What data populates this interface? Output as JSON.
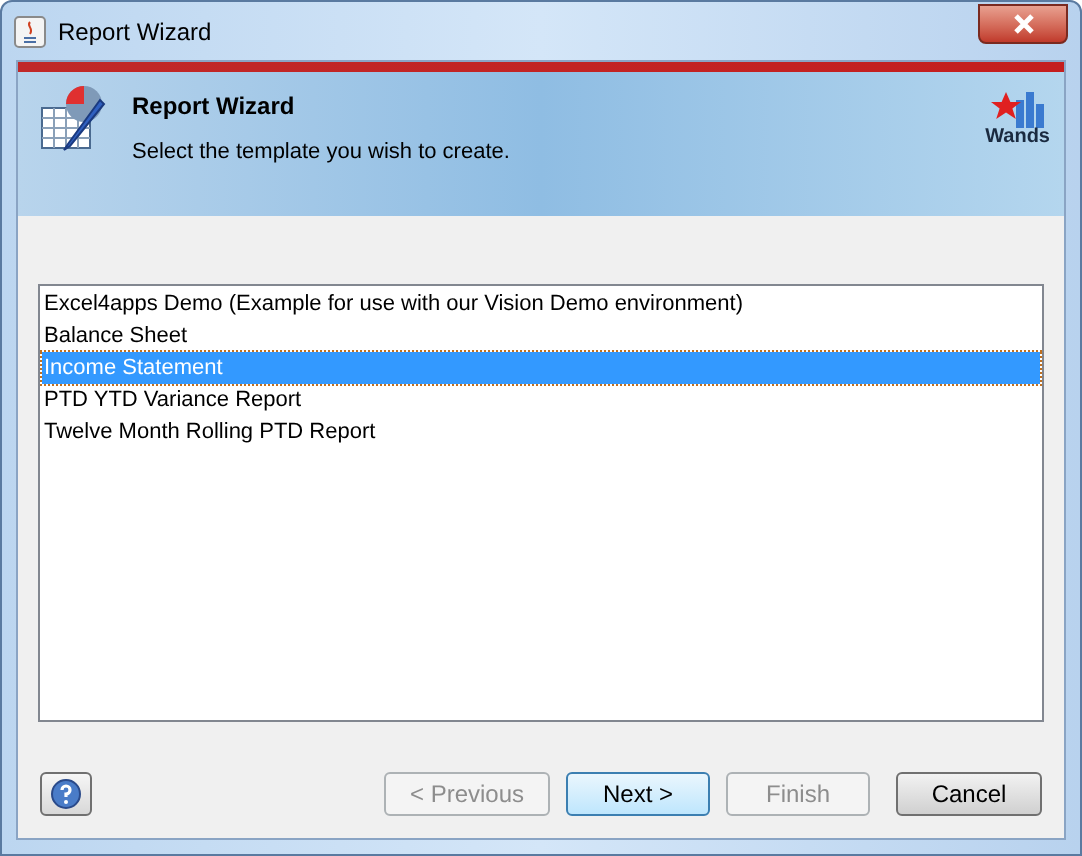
{
  "window": {
    "title": "Report Wizard"
  },
  "header": {
    "title": "Report Wizard",
    "subtitle": "Select the template you wish to create.",
    "logo_text": "Wands"
  },
  "templates": [
    {
      "label": "Excel4apps Demo (Example for use with our Vision Demo environment)",
      "selected": false
    },
    {
      "label": "Balance Sheet",
      "selected": false
    },
    {
      "label": "Income Statement",
      "selected": true
    },
    {
      "label": "PTD YTD Variance Report",
      "selected": false
    },
    {
      "label": "Twelve Month Rolling PTD Report",
      "selected": false
    }
  ],
  "buttons": [
    {
      "label": "< Previous",
      "disabled": true,
      "default": false
    },
    {
      "label": "Next >",
      "disabled": false,
      "default": true
    },
    {
      "label": "Finish",
      "disabled": true,
      "default": false
    },
    {
      "label": "Cancel",
      "disabled": false,
      "default": false
    }
  ]
}
